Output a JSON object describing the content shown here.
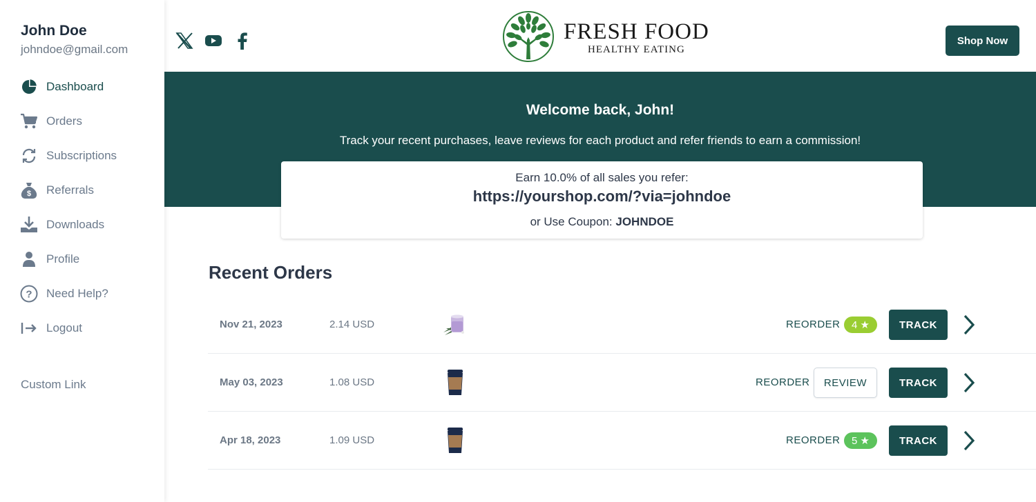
{
  "user": {
    "name": "John Doe",
    "email": "johndoe@gmail.com"
  },
  "sidebar": {
    "items": [
      {
        "label": "Dashboard",
        "icon": "pie-chart-icon",
        "active": true
      },
      {
        "label": "Orders",
        "icon": "cart-icon"
      },
      {
        "label": "Subscriptions",
        "icon": "refresh-icon"
      },
      {
        "label": "Referrals",
        "icon": "money-bag-icon"
      },
      {
        "label": "Downloads",
        "icon": "download-icon"
      },
      {
        "label": "Profile",
        "icon": "person-icon"
      },
      {
        "label": "Need Help?",
        "icon": "help-icon"
      },
      {
        "label": "Logout",
        "icon": "logout-icon"
      }
    ],
    "custom_link": "Custom Link"
  },
  "header": {
    "social": [
      "x-icon",
      "youtube-icon",
      "facebook-icon"
    ],
    "logo_title": "FRESH FOOD",
    "logo_subtitle": "HEALTHY EATING",
    "shop_button": "Shop Now"
  },
  "banner": {
    "welcome": "Welcome back, John!",
    "tagline": "Track your recent purchases, leave reviews for each product and refer friends to earn a commission!"
  },
  "referral": {
    "earn_text": "Earn 10.0% of all sales you refer:",
    "link": "https://yourshop.com/?via=johndoe",
    "coupon_prefix": "or Use Coupon: ",
    "coupon_code": "JOHNDOE"
  },
  "orders": {
    "title": "Recent Orders",
    "reorder_label": "REORDER",
    "review_label": "REVIEW",
    "track_label": "TRACK",
    "rows": [
      {
        "date": "Nov 21, 2023",
        "price": "2.14 USD",
        "product_image": "candle-image",
        "rating": "4 ★",
        "rating_color": "#9acd32"
      },
      {
        "date": "May 03, 2023",
        "price": "1.08 USD",
        "product_image": "coffee-cup-image",
        "rating": null
      },
      {
        "date": "Apr 18, 2023",
        "price": "1.09 USD",
        "product_image": "coffee-cup-image",
        "rating": "5 ★",
        "rating_color": "#5cc35c"
      }
    ]
  },
  "colors": {
    "brand": "#1a4d4d",
    "text": "#2d3748",
    "muted": "#6b7785"
  }
}
